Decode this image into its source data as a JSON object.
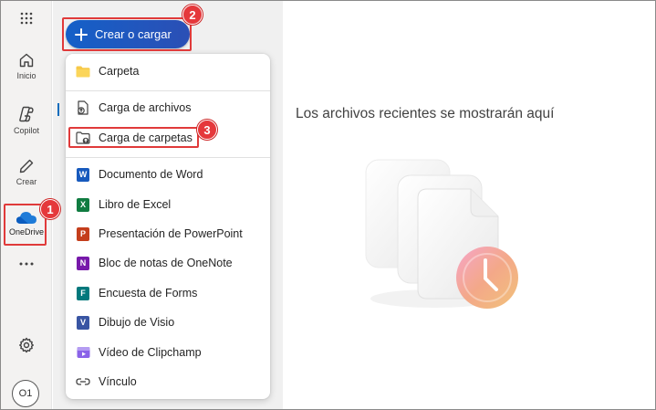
{
  "rail": {
    "home_label": "Inicio",
    "copilot_label": "Copilot",
    "create_label": "Crear",
    "onedrive_label": "OneDrive",
    "avatar_initials": "O1"
  },
  "create_button": {
    "label": "Crear o cargar"
  },
  "menu": {
    "items": [
      {
        "label": "Carpeta",
        "icon": "folder-icon"
      },
      {
        "label": "Carga de archivos",
        "icon": "file-upload-icon"
      },
      {
        "label": "Carga de carpetas",
        "icon": "folder-upload-icon"
      },
      {
        "label": "Documento de Word",
        "icon": "word-icon",
        "letter": "W"
      },
      {
        "label": "Libro de Excel",
        "icon": "excel-icon",
        "letter": "X"
      },
      {
        "label": "Presentación de PowerPoint",
        "icon": "powerpoint-icon",
        "letter": "P"
      },
      {
        "label": "Bloc de notas de OneNote",
        "icon": "onenote-icon",
        "letter": "N"
      },
      {
        "label": "Encuesta de Forms",
        "icon": "forms-icon",
        "letter": "F"
      },
      {
        "label": "Dibujo de Visio",
        "icon": "visio-icon",
        "letter": "V"
      },
      {
        "label": "Vídeo de Clipchamp",
        "icon": "clipchamp-icon"
      },
      {
        "label": "Vínculo",
        "icon": "link-icon"
      }
    ]
  },
  "main": {
    "empty_message": "Los archivos recientes se mostrarán aquí"
  },
  "annotations": [
    "1",
    "2",
    "3"
  ],
  "colors": {
    "accent": "#0f6cbd",
    "annotation_red": "#e5383b",
    "word": "#185abd",
    "excel": "#107c41",
    "powerpoint": "#c43e1c",
    "onenote": "#7719aa",
    "forms": "#03787c",
    "visio": "#3955a3",
    "clipchamp": "#7b5cd6"
  }
}
